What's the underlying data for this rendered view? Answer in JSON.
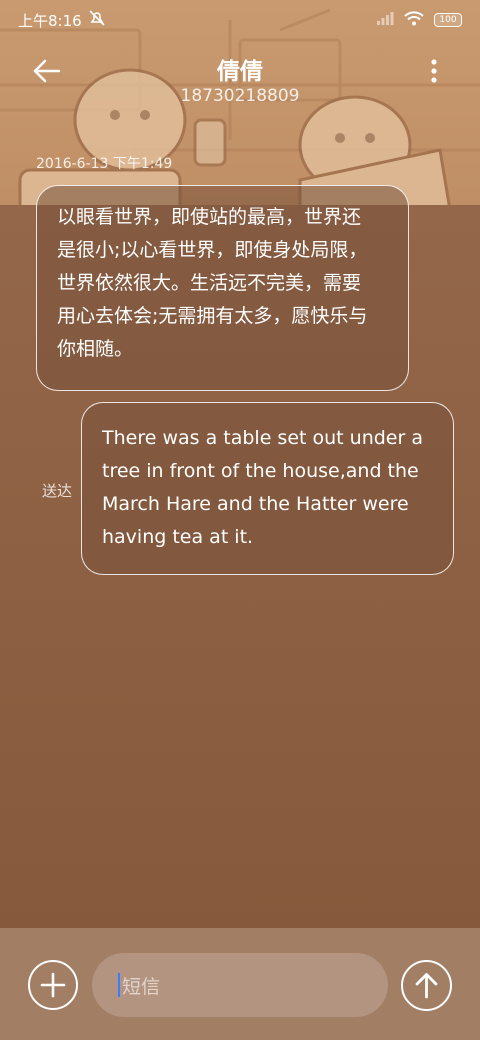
{
  "status_bar": {
    "time": "上午8:16",
    "battery": "100"
  },
  "header": {
    "title": "倩倩",
    "phone": "18730218809"
  },
  "conversation": {
    "timestamp": "2016-6-13 下午1:49",
    "messages": [
      {
        "direction": "incoming",
        "lines": [
          "以眼看世界，即使站的最高，世界还",
          "是很小;以心看世界，即使身处局限，",
          "世界依然很大。生活远不完美，需要",
          "用心去体会;无需拥有太多，愿快乐与",
          "你相随。"
        ]
      },
      {
        "direction": "outgoing",
        "lines": [
          "There was a table set out under a",
          "tree in front of the house,and the",
          "March Hare and the Hatter were",
          "having tea at it."
        ],
        "status": "送达"
      }
    ]
  },
  "composer": {
    "placeholder": "短信"
  },
  "icons": {
    "back": "arrow-left-icon",
    "more": "vertical-dots-icon",
    "add": "plus-icon",
    "send": "arrow-up-icon"
  },
  "colors": {
    "background": "#8a5f43",
    "top_background": "#c99a6f",
    "input_background": "#b39480",
    "caret": "#3b7bff"
  }
}
